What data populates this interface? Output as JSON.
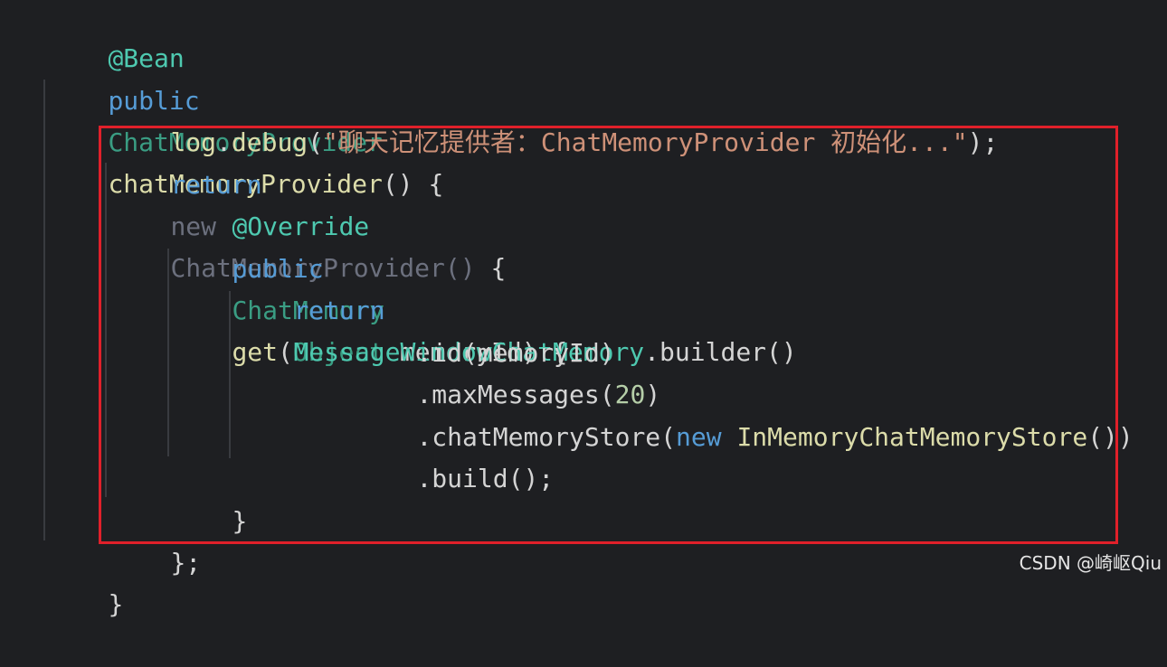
{
  "code": {
    "l1": {
      "ann": "@Bean"
    },
    "l2": {
      "kw": "public",
      "type": "ChatMemoryProvider",
      "fn": "chatMemoryProvider",
      "rest": "() {"
    },
    "l3": {
      "obj": "log",
      "dot": ".",
      "fn": "debug",
      "open": "(",
      "str": "\"聊天记忆提供者：ChatMemoryProvider 初始化...\"",
      "close": ");"
    },
    "l4": {
      "kw": "return",
      "new": "new",
      "type": "ChatMemoryProvider()",
      "rest": " {"
    },
    "l5": {
      "ann": "@Override"
    },
    "l6": {
      "kw": "public",
      "type": "ChatMemory",
      "fn": "get",
      "open": "(",
      "ptype": "Object",
      "param": " memoryId) {"
    },
    "l7": {
      "kw": "return",
      "type": "MessageWindowChatMemory",
      "rest": ".builder()"
    },
    "l8": {
      "text": ".id(memoryId)"
    },
    "l9": {
      "pre": ".maxMessages(",
      "num": "20",
      "post": ")"
    },
    "l10": {
      "pre": ".chatMemoryStore(",
      "kw": "new",
      "type": "InMemoryChatMemoryStore",
      "post": "())"
    },
    "l11": {
      "text": ".build();"
    },
    "l12": {
      "text": "}"
    },
    "l13": {
      "text": "};"
    },
    "l14": {
      "text": "}"
    }
  },
  "watermark": "CSDN @崎岖Qiu",
  "colors": {
    "background": "#1e1f22",
    "highlight_border": "#e0202a"
  }
}
